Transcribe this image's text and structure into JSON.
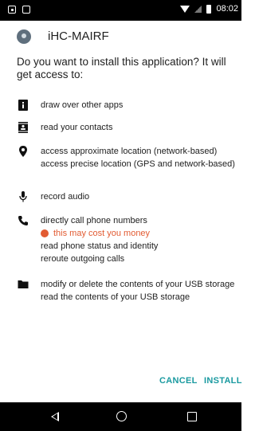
{
  "status_bar": {
    "time": "08:02"
  },
  "app": {
    "name": "iHC-MAIRF"
  },
  "question": "Do you want to install this application? It will get access to:",
  "permissions": [
    {
      "icon": "info-icon",
      "lines": [
        "draw over other apps"
      ]
    },
    {
      "icon": "contacts-icon",
      "lines": [
        "read your contacts"
      ]
    },
    {
      "icon": "location-pin-icon",
      "lines": [
        "access approximate location (network-based)",
        "access precise location (GPS and network-based)"
      ]
    },
    {
      "icon": "microphone-icon",
      "lines": [
        "record audio"
      ]
    },
    {
      "icon": "phone-icon",
      "warning": "this may cost you money",
      "lines": [
        "directly call phone numbers",
        "read phone status and identity",
        "reroute outgoing calls"
      ]
    },
    {
      "icon": "folder-icon",
      "lines": [
        "modify or delete the contents of your USB storage",
        "read the contents of your USB storage"
      ]
    }
  ],
  "actions": {
    "cancel": "CANCEL",
    "install": "INSTALL"
  },
  "colors": {
    "accent": "#1a9aa0",
    "warning": "#e25b32",
    "bars": "#000000"
  }
}
